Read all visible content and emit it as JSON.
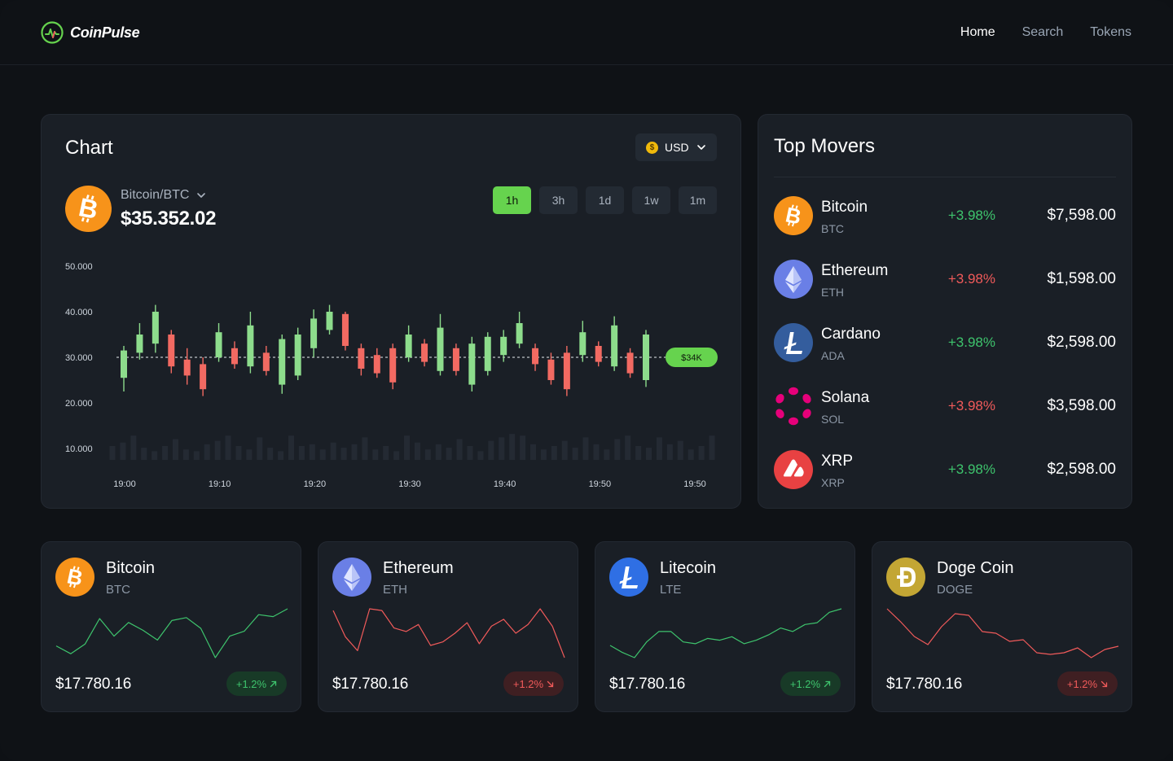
{
  "brand": {
    "name": "CoinPulse"
  },
  "nav": [
    {
      "label": "Home",
      "active": true
    },
    {
      "label": "Search",
      "active": false
    },
    {
      "label": "Tokens",
      "active": false
    }
  ],
  "chart_card": {
    "title": "Chart",
    "currency": {
      "symbol": "$",
      "label": "USD"
    },
    "pair": {
      "name": "Bitcoin/BTC",
      "price": "$35.352.02"
    },
    "intervals": [
      {
        "label": "1h",
        "active": true
      },
      {
        "label": "3h",
        "active": false
      },
      {
        "label": "1d",
        "active": false
      },
      {
        "label": "1w",
        "active": false
      },
      {
        "label": "1m",
        "active": false
      }
    ]
  },
  "chart_data": {
    "type": "candlestick",
    "y_ticks": [
      "50.000",
      "40.000",
      "30.000",
      "20.000",
      "10.000"
    ],
    "ylim": [
      10000,
      50000
    ],
    "x_ticks": [
      "19:00",
      "19:10",
      "19:20",
      "19:30",
      "19:40",
      "19:50",
      "19:50"
    ],
    "current_price_marker": {
      "label": "$34K",
      "value": 30000
    },
    "up_color": "#8ddc8c",
    "down_color": "#f26a62",
    "candles": [
      {
        "o": 25500,
        "c": 31500,
        "h": 32500,
        "l": 22500
      },
      {
        "o": 31000,
        "c": 35000,
        "h": 37500,
        "l": 29500
      },
      {
        "o": 33000,
        "c": 40000,
        "h": 41500,
        "l": 31000
      },
      {
        "o": 35000,
        "c": 28000,
        "h": 36000,
        "l": 26500
      },
      {
        "o": 29500,
        "c": 26000,
        "h": 32000,
        "l": 24000
      },
      {
        "o": 28500,
        "c": 23000,
        "h": 30000,
        "l": 21500
      },
      {
        "o": 30000,
        "c": 35500,
        "h": 37500,
        "l": 29000
      },
      {
        "o": 32000,
        "c": 28500,
        "h": 33500,
        "l": 27500
      },
      {
        "o": 28000,
        "c": 37000,
        "h": 40000,
        "l": 26500
      },
      {
        "o": 31000,
        "c": 27000,
        "h": 32500,
        "l": 26000
      },
      {
        "o": 24000,
        "c": 34000,
        "h": 35000,
        "l": 22000
      },
      {
        "o": 26000,
        "c": 35000,
        "h": 36500,
        "l": 25000
      },
      {
        "o": 32000,
        "c": 38500,
        "h": 40500,
        "l": 30000
      },
      {
        "o": 36000,
        "c": 40000,
        "h": 41500,
        "l": 35000
      },
      {
        "o": 39500,
        "c": 32500,
        "h": 40000,
        "l": 31500
      },
      {
        "o": 32000,
        "c": 27500,
        "h": 33000,
        "l": 26000
      },
      {
        "o": 30500,
        "c": 26500,
        "h": 32000,
        "l": 25500
      },
      {
        "o": 32000,
        "c": 24500,
        "h": 33000,
        "l": 23000
      },
      {
        "o": 30000,
        "c": 35000,
        "h": 37000,
        "l": 29000
      },
      {
        "o": 33000,
        "c": 29000,
        "h": 34000,
        "l": 28000
      },
      {
        "o": 27000,
        "c": 36500,
        "h": 39500,
        "l": 26000
      },
      {
        "o": 32000,
        "c": 27000,
        "h": 33000,
        "l": 26000
      },
      {
        "o": 24000,
        "c": 33000,
        "h": 34500,
        "l": 22500
      },
      {
        "o": 27000,
        "c": 34500,
        "h": 35500,
        "l": 26000
      },
      {
        "o": 30500,
        "c": 34500,
        "h": 36000,
        "l": 29000
      },
      {
        "o": 33000,
        "c": 37500,
        "h": 40000,
        "l": 32000
      },
      {
        "o": 32000,
        "c": 28500,
        "h": 33000,
        "l": 27000
      },
      {
        "o": 29500,
        "c": 25000,
        "h": 31000,
        "l": 24000
      },
      {
        "o": 31000,
        "c": 23000,
        "h": 32500,
        "l": 21500
      },
      {
        "o": 30500,
        "c": 35500,
        "h": 38000,
        "l": 29000
      },
      {
        "o": 32500,
        "c": 29000,
        "h": 33500,
        "l": 28000
      },
      {
        "o": 28000,
        "c": 37000,
        "h": 39000,
        "l": 27000
      },
      {
        "o": 31000,
        "c": 26500,
        "h": 32000,
        "l": 25500
      },
      {
        "o": 25000,
        "c": 35000,
        "h": 36000,
        "l": 23500
      }
    ],
    "volume": [
      8,
      10,
      14,
      7,
      5,
      8,
      12,
      6,
      5,
      9,
      11,
      14,
      8,
      6,
      13,
      7,
      5,
      14,
      8,
      9,
      6,
      10,
      7,
      9,
      13,
      6,
      8,
      5,
      14,
      10,
      6,
      9,
      7,
      12,
      8,
      5,
      11,
      13,
      15,
      14,
      9,
      6,
      8,
      11,
      7,
      13,
      9,
      6,
      12,
      14,
      8,
      7,
      13,
      9,
      11,
      6,
      8,
      14
    ],
    "volume_max": 16
  },
  "top_movers": {
    "title": "Top Movers",
    "items": [
      {
        "name": "Bitcoin",
        "symbol": "BTC",
        "change": "+3.98%",
        "direction": "up",
        "price": "$7,598.00",
        "icon": "bitcoin-icon"
      },
      {
        "name": "Ethereum",
        "symbol": "ETH",
        "change": "+3.98%",
        "direction": "down",
        "price": "$1,598.00",
        "icon": "ethereum-icon"
      },
      {
        "name": "Cardano",
        "symbol": "ADA",
        "change": "+3.98%",
        "direction": "up",
        "price": "$2,598.00",
        "icon": "litecoin-icon"
      },
      {
        "name": "Solana",
        "symbol": "SOL",
        "change": "+3.98%",
        "direction": "down",
        "price": "$3,598.00",
        "icon": "polkadot-icon"
      },
      {
        "name": "XRP",
        "symbol": "XRP",
        "change": "+3.98%",
        "direction": "up",
        "price": "$2,598.00",
        "icon": "avalanche-icon"
      }
    ]
  },
  "coin_cards": [
    {
      "name": "Bitcoin",
      "symbol": "BTC",
      "price": "$17.780.16",
      "change": "+1.2%",
      "direction": "up",
      "icon": "bitcoin-icon",
      "spark": [
        38,
        46,
        36,
        10,
        28,
        14,
        22,
        32,
        12,
        9,
        20,
        50,
        28,
        23,
        6,
        8,
        0
      ]
    },
    {
      "name": "Ethereum",
      "symbol": "ETH",
      "price": "$17.780.16",
      "change": "+1.2%",
      "direction": "down",
      "icon": "ethereum-icon",
      "spark": [
        2,
        32,
        48,
        0,
        2,
        22,
        26,
        18,
        42,
        38,
        28,
        16,
        40,
        20,
        12,
        28,
        18,
        0,
        20,
        56
      ]
    },
    {
      "name": "Litecoin",
      "symbol": "LTE",
      "price": "$17.780.16",
      "change": "+1.2%",
      "direction": "up",
      "icon": "litecoin-icon",
      "spark": [
        42,
        50,
        56,
        38,
        26,
        26,
        38,
        40,
        34,
        36,
        32,
        40,
        36,
        30,
        22,
        26,
        18,
        16,
        4,
        0
      ]
    },
    {
      "name": "Doge Coin",
      "symbol": "DOGE",
      "price": "$17.780.16",
      "change": "+1.2%",
      "direction": "down",
      "icon": "dogecoin-icon",
      "spark": [
        0,
        16,
        34,
        44,
        22,
        6,
        8,
        28,
        30,
        40,
        38,
        54,
        56,
        54,
        48,
        60,
        50,
        46
      ]
    }
  ]
}
